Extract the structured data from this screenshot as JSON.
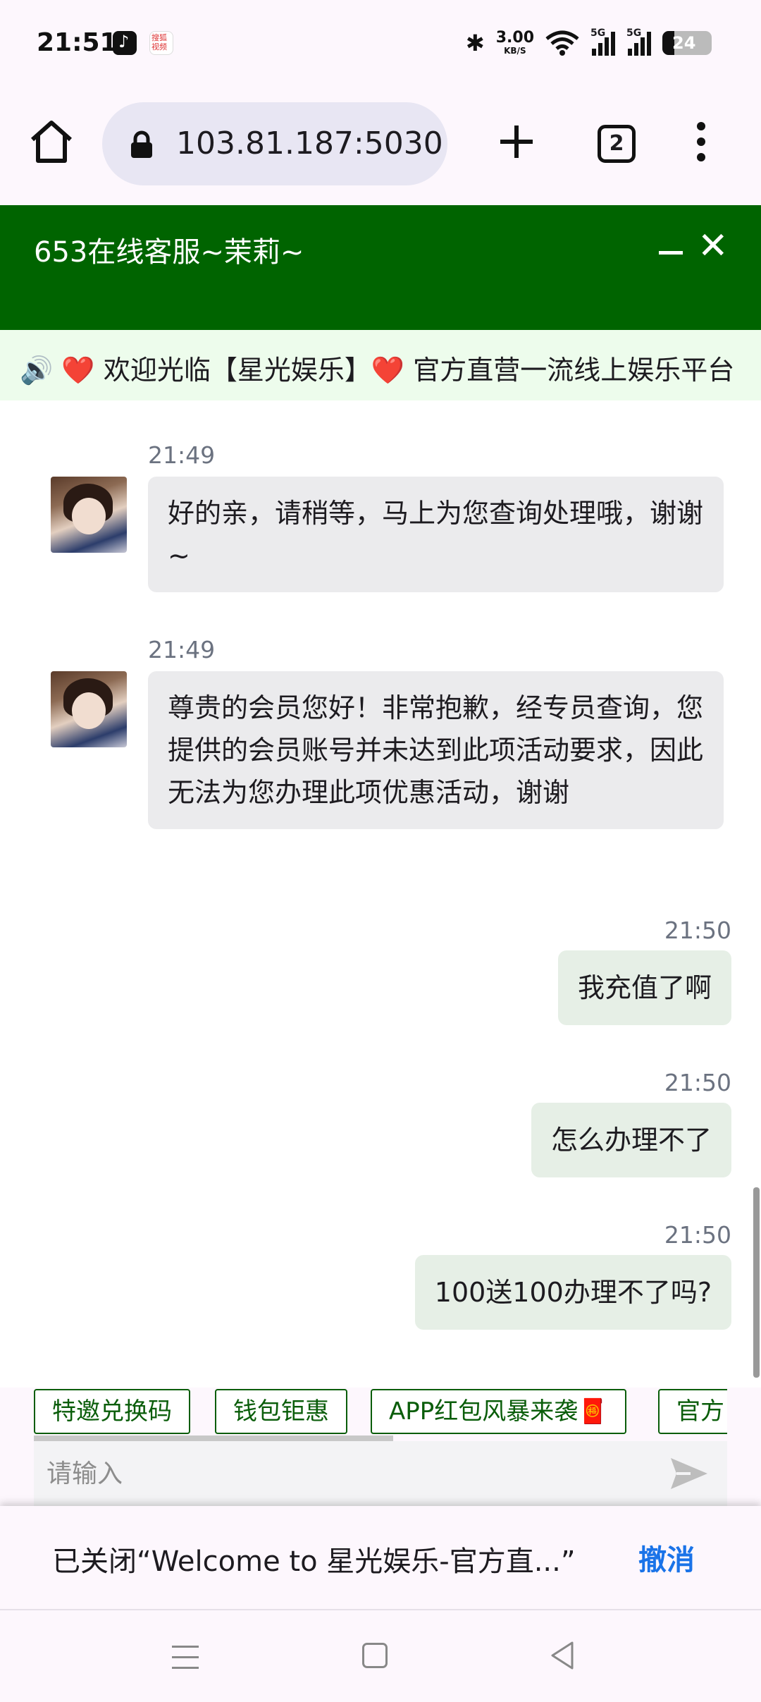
{
  "status_bar": {
    "time": "21:51",
    "net_speed_value": "3.00",
    "net_speed_unit": "KB/S",
    "signal_label_1": "5G",
    "signal_label_2": "5G",
    "battery": "24",
    "app_icons": [
      "tiktok-icon",
      "sohu-video-icon"
    ],
    "sohu_label": "搜狐视频"
  },
  "browser": {
    "url": "103.81.187:5030",
    "tab_count": "2"
  },
  "chat": {
    "title": "653在线客服~茉莉~",
    "header_color": "#006400",
    "marquee": "❤️ 欢迎光临【星光娱乐】❤️ 官方直营一流线上娱乐平台",
    "messages": [
      {
        "side": "in",
        "time": "21:49",
        "text": "好的亲，请稍等，马上为您查询处理哦，谢谢~"
      },
      {
        "side": "in",
        "time": "21:49",
        "text": "尊贵的会员您好！非常抱歉，经专员查询，您提供的会员账号并未达到此项活动要求，因此无法为您办理此项优惠活动，谢谢"
      },
      {
        "side": "out",
        "time": "21:50",
        "text": "我充值了啊"
      },
      {
        "side": "out",
        "time": "21:50",
        "text": "怎么办理不了"
      },
      {
        "side": "out",
        "time": "21:50",
        "text": "100送100办理不了吗?"
      }
    ],
    "quick_replies": [
      "特邀兑换码",
      "钱包钜惠",
      "APP红包风暴来袭🧧",
      "官方"
    ],
    "input_placeholder": "请输入"
  },
  "snackbar": {
    "text": "已关闭“Welcome to 星光娱乐-官方直...”",
    "action": "撤消",
    "action_color": "#1a73e8"
  }
}
